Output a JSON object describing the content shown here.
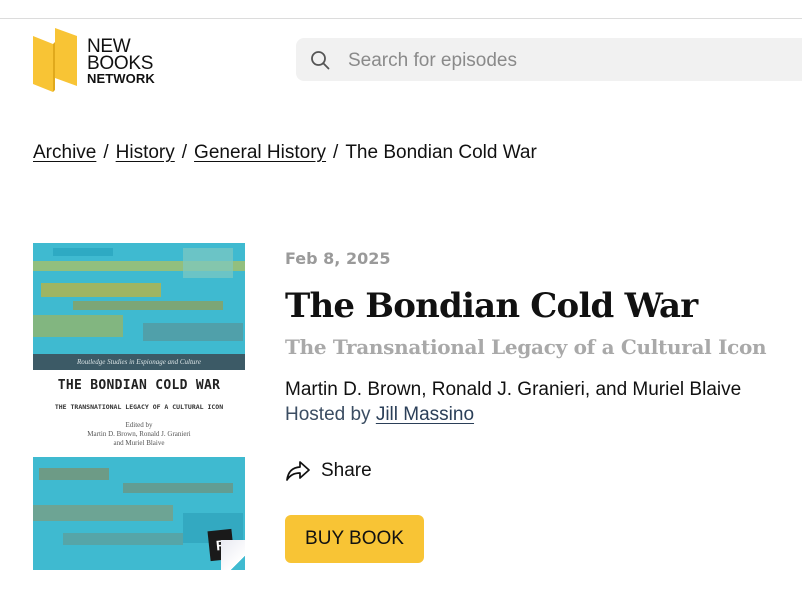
{
  "brand": {
    "line1": "NEW",
    "line2": "BOOKS",
    "line3": "NETWORK",
    "accent": "#f8c435"
  },
  "search": {
    "placeholder": "Search for episodes",
    "value": "",
    "icon": "search-icon"
  },
  "breadcrumb": {
    "items": [
      "Archive",
      "History",
      "General History"
    ],
    "separator": "/",
    "current": "The Bondian Cold War"
  },
  "cover": {
    "series": "Routledge Studies in Espionage and Culture",
    "title": "THE BONDIAN COLD WAR",
    "subtitle": "THE TRANSNATIONAL LEGACY OF A CULTURAL ICON",
    "edited_by": "Edited by",
    "editors_line1": "Martin D. Brown, Ronald J. Granieri",
    "editors_line2": "and Muriel Blaive",
    "publisher_mark": "R"
  },
  "episode": {
    "date": "Feb 8, 2025",
    "title": "The Bondian Cold War",
    "subtitle": "The Transnational Legacy of a Cultural Icon",
    "authors": "Martin D. Brown, Ronald J. Granieri, and Muriel Blaive",
    "hosted_prefix": "Hosted by",
    "host": "Jill Massino"
  },
  "actions": {
    "share_label": "Share",
    "share_icon": "share-icon",
    "buy_label": "BUY BOOK"
  }
}
